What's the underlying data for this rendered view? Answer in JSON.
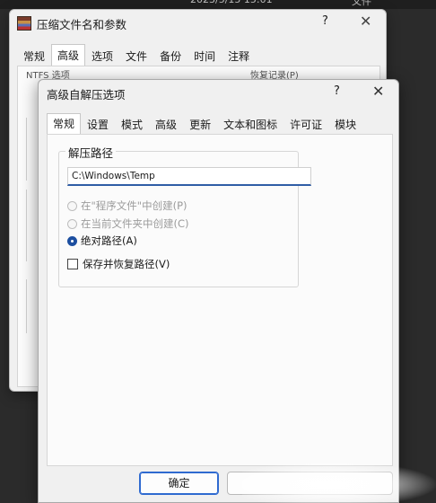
{
  "background_window": {
    "title": "压缩文件名和参数",
    "help": "?",
    "close": "✕",
    "tabs": [
      "常规",
      "高级",
      "选项",
      "文件",
      "备份",
      "时间",
      "注释"
    ],
    "active_tab_index": 1,
    "partial_left_label": "NTFS 选项",
    "partial_right_label": "恢复记录(P)"
  },
  "dialog": {
    "title": "高级自解压选项",
    "help": "?",
    "close": "✕",
    "tabs": [
      "常规",
      "设置",
      "模式",
      "高级",
      "更新",
      "文本和图标",
      "许可证",
      "模块"
    ],
    "active_tab_index": 0,
    "group_label": "解压路径",
    "path_value": "C:\\Windows\\Temp",
    "options": [
      {
        "label": "在\"程序文件\"中创建(P)",
        "checked": false,
        "disabled": true
      },
      {
        "label": "在当前文件夹中创建(C)",
        "checked": false,
        "disabled": true
      },
      {
        "label": "绝对路径(A)",
        "checked": true,
        "disabled": false
      }
    ],
    "checkbox_label": "保存并恢复路径(V)",
    "checkbox_checked": false,
    "ok_label": "确定",
    "cancel_label": ""
  }
}
